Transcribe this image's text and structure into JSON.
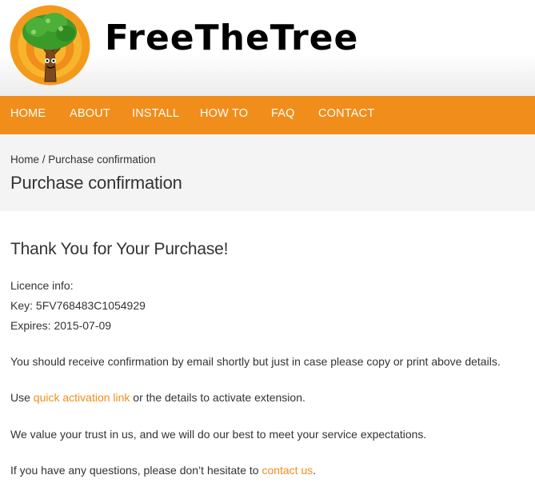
{
  "header": {
    "site_title": "FreeTheTree",
    "logo_icon": "tree-mascot-logo"
  },
  "nav": {
    "items": [
      "HOME",
      "ABOUT",
      "INSTALL",
      "HOW TO",
      "FAQ",
      "CONTACT"
    ],
    "color": "#f18d1a"
  },
  "breadcrumb": {
    "home": "Home",
    "separator": " / ",
    "current": "Purchase confirmation"
  },
  "page_title": "Purchase confirmation",
  "content": {
    "heading": "Thank You for Your Purchase!",
    "licence_label": "Licence info:",
    "key_line": "Key: 5FV768483C1054929",
    "expires_line": "Expires: 2015-07-09",
    "confirmation_text": "You should receive confirmation by email shortly but just in case please copy or print above details.",
    "activation_prefix": "Use ",
    "activation_link": "quick activation link",
    "activation_suffix": " or the details to activate extension.",
    "trust_text": "We value your trust in us, and we will do our best to meet your service expectations.",
    "questions_prefix": "If you have any questions, please don’t hesitate to ",
    "contact_link": "contact us",
    "questions_suffix": "."
  }
}
